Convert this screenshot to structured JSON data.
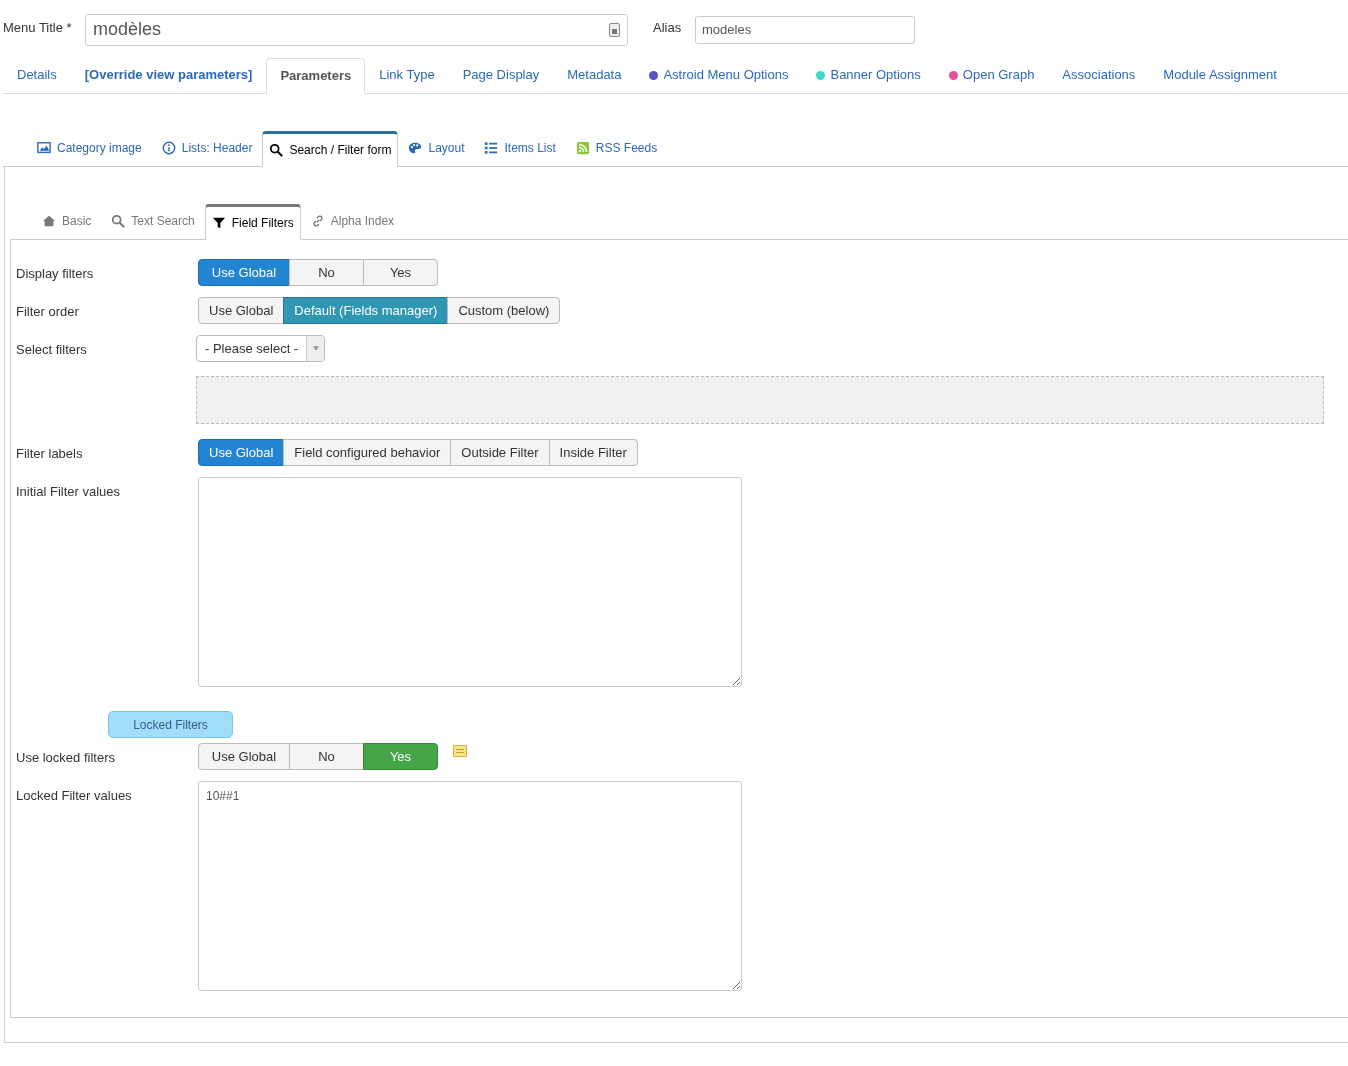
{
  "title_field": {
    "label": "Menu Title *",
    "value": "modèles"
  },
  "alias_field": {
    "label": "Alias",
    "value": "modeles"
  },
  "main_tabs": [
    {
      "label": "Details",
      "selected": false,
      "bold": false
    },
    {
      "label": "[Override view parameters]",
      "selected": false,
      "bold": true
    },
    {
      "label": "Parameters",
      "selected": true,
      "bold": false
    },
    {
      "label": "Link Type",
      "selected": false,
      "bold": false
    },
    {
      "label": "Page Display",
      "selected": false,
      "bold": false
    },
    {
      "label": "Metadata",
      "selected": false,
      "bold": false
    },
    {
      "label": "Astroid Menu Options",
      "selected": false,
      "bold": false,
      "color": "#5b4fc4"
    },
    {
      "label": "Banner Options",
      "selected": false,
      "bold": false,
      "color": "#3fd9c8"
    },
    {
      "label": "Open Graph",
      "selected": false,
      "bold": false,
      "color": "#e0509e"
    },
    {
      "label": "Associations",
      "selected": false,
      "bold": false
    },
    {
      "label": "Module Assignment",
      "selected": false,
      "bold": false
    }
  ],
  "sub_tabs": [
    {
      "label": "Category image",
      "selected": false
    },
    {
      "label": "Lists: Header",
      "selected": false
    },
    {
      "label": "Search / Filter form",
      "selected": true
    },
    {
      "label": "Layout",
      "selected": false
    },
    {
      "label": "Items List",
      "selected": false
    },
    {
      "label": "RSS Feeds",
      "selected": false
    }
  ],
  "inner_tabs": [
    {
      "label": "Basic",
      "selected": false
    },
    {
      "label": "Text Search",
      "selected": false
    },
    {
      "label": "Field Filters",
      "selected": true
    },
    {
      "label": "Alpha Index",
      "selected": false
    }
  ],
  "rows": [
    {
      "kind": "radio",
      "label": "Display filters",
      "options": [
        {
          "label": "Use Global",
          "selected": true
        },
        {
          "label": "No",
          "selected": false
        },
        {
          "label": "Yes",
          "selected": false
        }
      ]
    },
    {
      "kind": "radio",
      "label": "Filter order",
      "options": [
        {
          "label": "Use Global",
          "selected": false
        },
        {
          "label": "Default (Fields manager)",
          "selected": true
        },
        {
          "label": "Custom (below)",
          "selected": false
        }
      ]
    },
    {
      "kind": "select",
      "label": "Select filters",
      "value": "- Please select -"
    },
    {
      "kind": "dropzone"
    },
    {
      "kind": "radio",
      "label": "Filter labels",
      "options": [
        {
          "label": "Use Global",
          "selected": true
        },
        {
          "label": "Field configured behavior",
          "selected": false
        },
        {
          "label": "Outside Filter",
          "selected": false
        },
        {
          "label": "Inside Filter",
          "selected": false
        }
      ]
    },
    {
      "kind": "textarea",
      "label": "Initial Filter values",
      "value": ""
    },
    {
      "kind": "heading",
      "label": "Locked Filters"
    },
    {
      "kind": "radio",
      "label": "Use locked filters",
      "help": true,
      "options": [
        {
          "label": "Use Global",
          "selected": false
        },
        {
          "label": "No",
          "selected": false
        },
        {
          "label": "Yes",
          "selected": true
        }
      ]
    },
    {
      "kind": "textarea",
      "label": "Locked Filter values",
      "value": "10##1"
    }
  ]
}
